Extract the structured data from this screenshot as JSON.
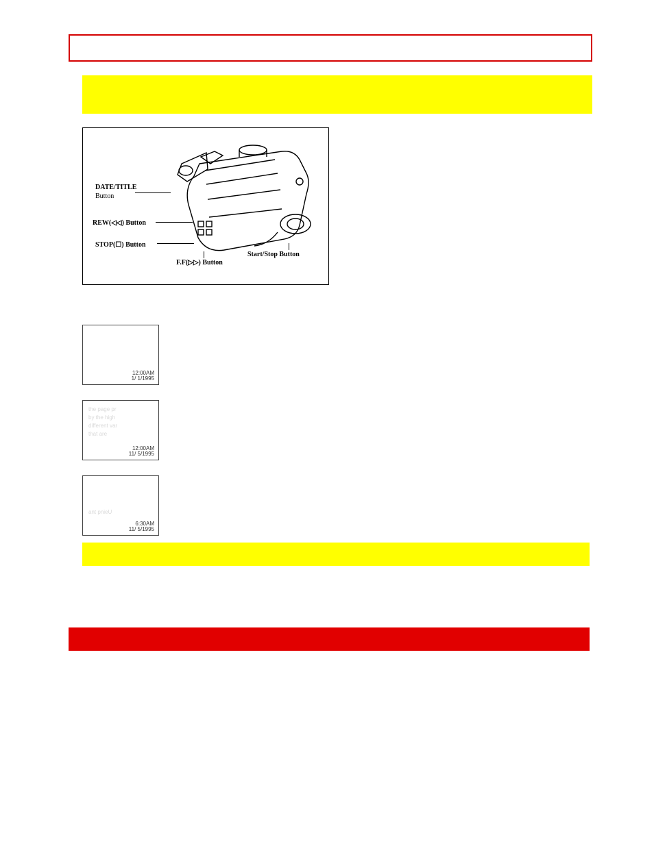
{
  "diagram": {
    "labels": {
      "date_title": "DATE/TITLE",
      "button": "Button",
      "rew": "REW(◁◁) Button",
      "stop": "STOP(☐) Button",
      "ff": "F.F(▷▷) Button",
      "start_stop": "Start/Stop Button"
    }
  },
  "thumbs": [
    {
      "time": "12:00AM",
      "date": "1/ 1/1995",
      "ghost": []
    },
    {
      "time": "12:00AM",
      "date": "11/ 5/1995",
      "ghost": [
        "the page pr",
        "by the high",
        "different var",
        "that are"
      ]
    },
    {
      "time": "6:30AM",
      "date": "11/ 5/1995",
      "ghost": [
        "ant pnieU"
      ]
    }
  ]
}
